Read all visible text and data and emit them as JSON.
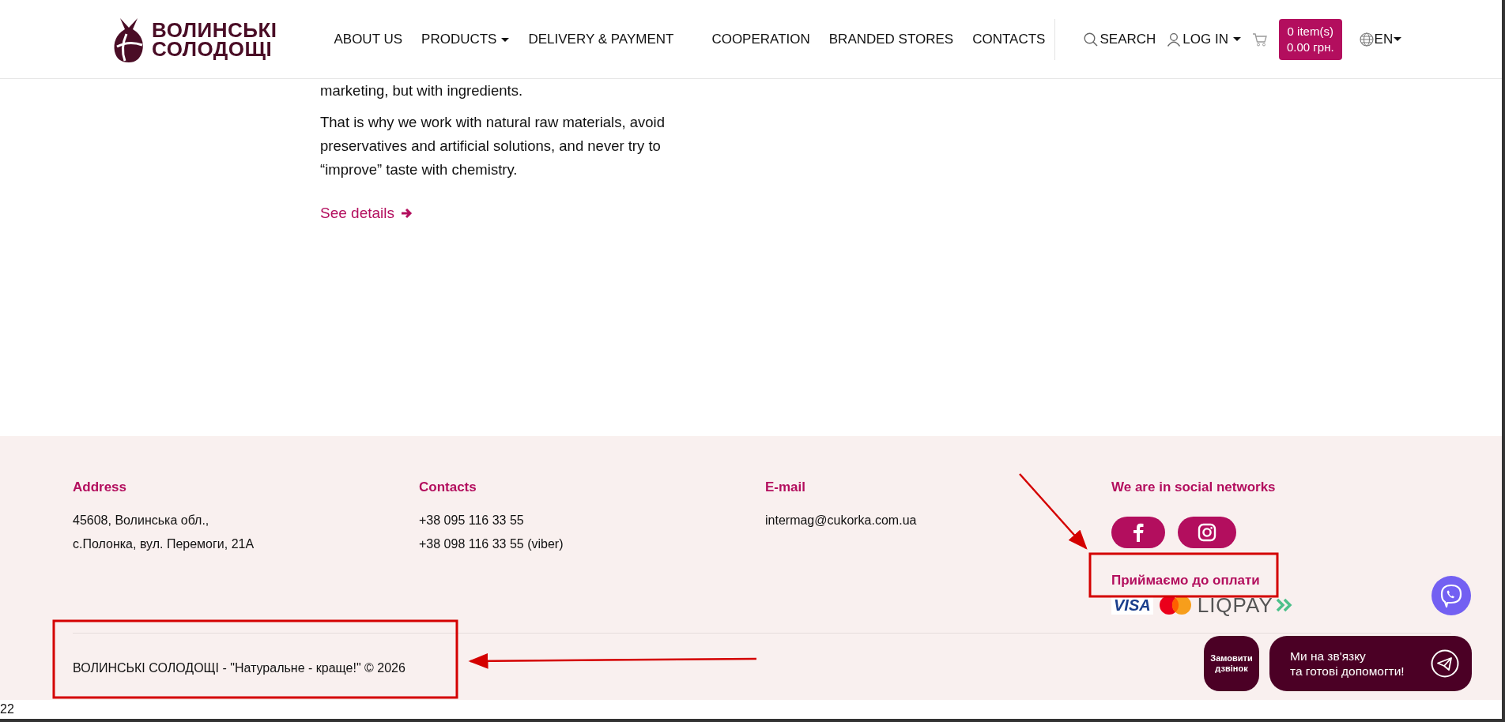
{
  "header": {
    "logo": {
      "line1": "ВОЛИНСЬКІ",
      "line2": "СОЛОДОЩІ"
    },
    "nav": [
      {
        "label": "ABOUT US",
        "dropdown": false
      },
      {
        "label": "PRODUCTS",
        "dropdown": true
      },
      {
        "label": "DELIVERY & PAYMENT",
        "dropdown": false
      },
      {
        "label": "COOPERATION",
        "dropdown": false
      },
      {
        "label": "BRANDED STORES",
        "dropdown": false
      },
      {
        "label": "CONTACTS",
        "dropdown": false
      }
    ],
    "search": "SEARCH",
    "login": "LOG IN",
    "cart": {
      "items": "0 item(s)",
      "total": "0.00 грн."
    },
    "language": "EN"
  },
  "content": {
    "paragraphs": [
      "marketing, but with ingredients.",
      "That is why we work with natural raw materials, avoid preservatives and artificial solutions, and never try to “improve” taste with chemistry."
    ],
    "link": "See details"
  },
  "footer": {
    "columns": [
      {
        "heading": "Address",
        "lines": [
          "45608, Волинська обл.,",
          "с.Полонка, вул. Перемоги, 21А"
        ]
      },
      {
        "heading": "Contacts",
        "lines": [
          "+38 095 116 33 55",
          "+38 098 116 33 55 (viber)"
        ]
      },
      {
        "heading": "E-mail",
        "lines": [
          "intermag@cukorka.com.ua"
        ]
      }
    ],
    "social": {
      "heading": "We are in social networks",
      "networks": [
        {
          "kind": "facebook"
        },
        {
          "kind": "instagram"
        }
      ]
    },
    "payment": {
      "heading": "Приймаємо до оплати",
      "logos": [
        {
          "kind": "visa",
          "text": "VISA"
        },
        {
          "kind": "mastercard"
        },
        {
          "kind": "liqpay",
          "text": "LIQPAY"
        }
      ]
    },
    "copyright": "ВОЛИНСЬКІ СОЛОДОЩІ - \"Натуральне - краще!\" © 2026"
  },
  "widgets": {
    "callback": "Замовити дзвінок",
    "chat": [
      "Ми на зв'язку",
      "та готові допомогти!"
    ]
  },
  "page_number": "22"
}
